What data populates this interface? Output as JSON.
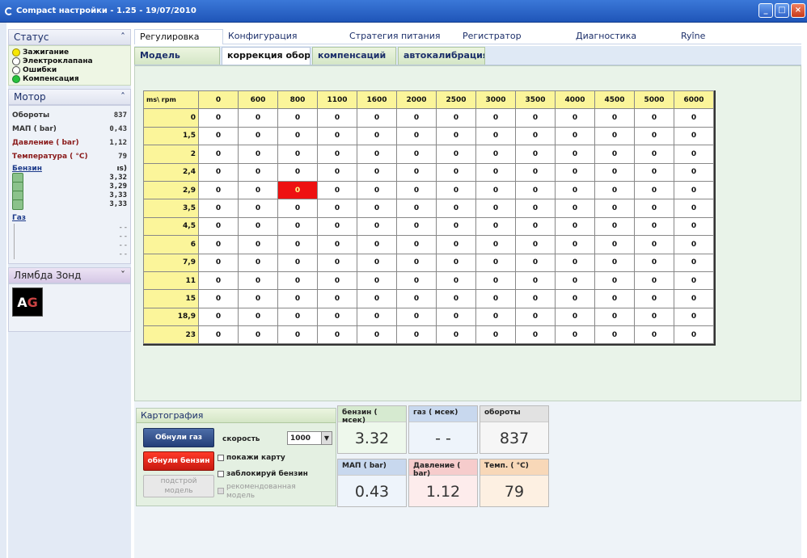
{
  "window": {
    "title": "Compact настройки - 1.25 - 19/07/2010"
  },
  "sidebar": {
    "status": {
      "title": "Статус",
      "items": [
        {
          "label": "Зажигание",
          "color": "yellow"
        },
        {
          "label": "Электроклапана",
          "color": "white"
        },
        {
          "label": "Ошибки",
          "color": "white"
        },
        {
          "label": "Компенсация",
          "color": "green"
        }
      ]
    },
    "motor": {
      "title": "Мотор",
      "rpm_label": "Обороты",
      "rpm_value": "837",
      "map_label": "МАП ( bar)",
      "map_value": "0,43",
      "pressure_label": "Давление ( bar)",
      "pressure_value": "1,12",
      "temp_label": "Температура ( °C)",
      "temp_value": "79",
      "petrol_label": "Бензин",
      "petrol_unit": "ıs)",
      "petrol_values": [
        "3,32",
        "3,29",
        "3,33",
        "3,33"
      ],
      "gas_label": "Газ",
      "gas_values": [
        "- -",
        "- -",
        "- -",
        "- -"
      ]
    },
    "lambda": {
      "title": "Лямбда Зонд"
    }
  },
  "tabs_main": [
    "Регулировка",
    "Конфигурация",
    "Стратегия питания",
    "Регистратор",
    "Диагностика",
    "Ryîne"
  ],
  "tabs_sub": [
    "Модель",
    "коррекция оборотов",
    "компенсаций",
    "автокалибрация"
  ],
  "grid": {
    "corner": "ms\\ rpm",
    "columns": [
      "0",
      "600",
      "800",
      "1100",
      "1600",
      "2000",
      "2500",
      "3000",
      "3500",
      "4000",
      "4500",
      "5000",
      "6000"
    ],
    "rows": [
      "0",
      "1,5",
      "2",
      "2,4",
      "2,9",
      "3,5",
      "4,5",
      "6",
      "7,9",
      "11",
      "15",
      "18,9",
      "23"
    ],
    "cell_value": "0",
    "highlight": {
      "row": 4,
      "col": 2
    }
  },
  "carto": {
    "title": "Картография",
    "reset_gas": "Обнули газ",
    "reset_petrol": "обнули бензин",
    "adjust_model_1": "подстрой",
    "adjust_model_2": "модель",
    "speed_label": "скорость",
    "speed_value": "1000",
    "show_map": "покажи карту",
    "lock_petrol": "заблокируй бензин",
    "recommended_1": "рекомендованная",
    "recommended_2": "модель"
  },
  "tiles": {
    "petrol": {
      "label": "бензин ( мсек)",
      "value": "3.32"
    },
    "gas": {
      "label": "газ ( мсек)",
      "value": "- -"
    },
    "rpm": {
      "label": "обороты",
      "value": "837"
    },
    "map": {
      "label": "МАП ( bar)",
      "value": "0.43"
    },
    "pressure": {
      "label": "Давление ( bar)",
      "value": "1.12"
    },
    "temp": {
      "label": "Темп. ( °C)",
      "value": "79"
    }
  }
}
